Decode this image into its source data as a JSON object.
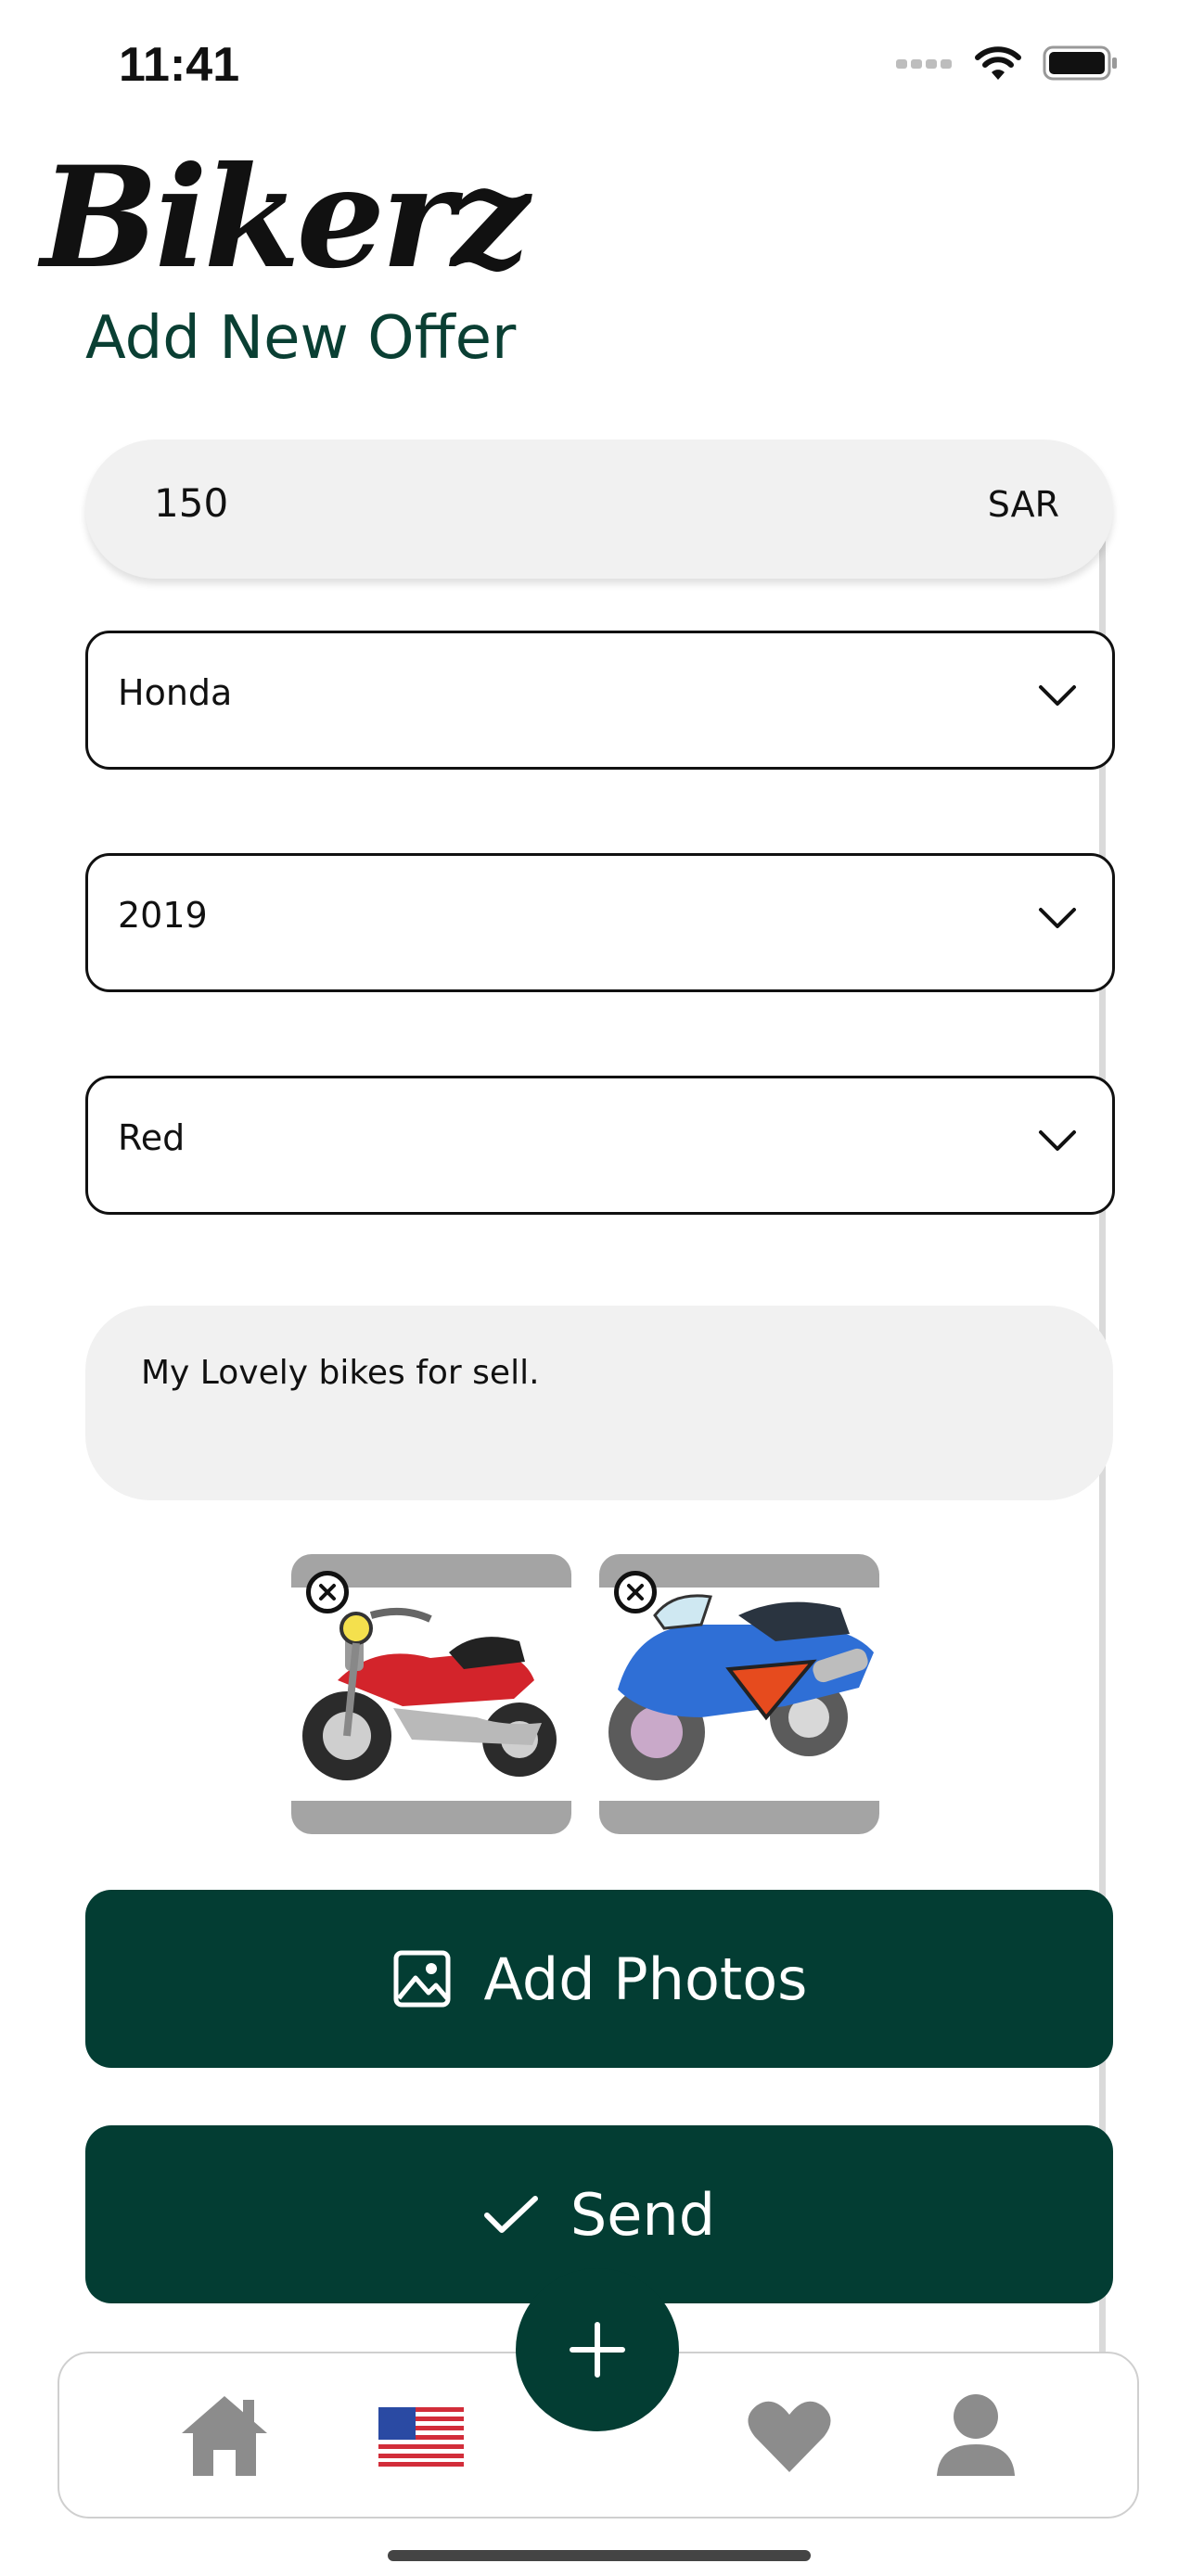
{
  "status_bar": {
    "time": "11:41"
  },
  "app": {
    "logo_text": "Bikerz",
    "page_title": "Add New Offer"
  },
  "form": {
    "price": {
      "value": "150",
      "currency": "SAR"
    },
    "brand": {
      "value": "Honda"
    },
    "year": {
      "value": "2019"
    },
    "color": {
      "value": "Red"
    },
    "description": {
      "value": "My Lovely bikes for sell."
    },
    "photos": [
      {
        "name": "red-motorcycle-photo",
        "color": "#d3242b"
      },
      {
        "name": "blue-motorcycle-photo",
        "color": "#2f6fd6"
      }
    ]
  },
  "buttons": {
    "add_photos": "Add Photos",
    "send": "Send"
  },
  "tab_bar": {
    "items": [
      {
        "icon": "home-icon"
      },
      {
        "icon": "us-flag-icon"
      },
      {
        "icon": "heart-icon"
      },
      {
        "icon": "profile-icon"
      }
    ],
    "fab_icon": "plus-icon"
  },
  "colors": {
    "primary": "#033d33",
    "field_bg": "#f1f1f1",
    "tab_icon": "#8c8c8c"
  }
}
